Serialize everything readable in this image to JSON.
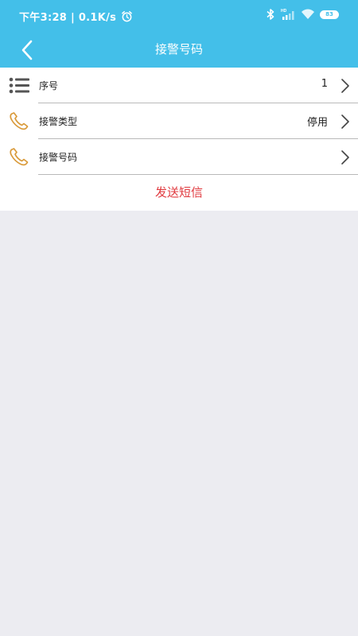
{
  "status_bar": {
    "time_speed": "下午3:28 | 0.1K/s",
    "battery": "83",
    "icons": [
      "alarm-icon",
      "bluetooth-icon",
      "signal-icon",
      "wifi-icon",
      "battery-icon"
    ]
  },
  "header": {
    "title": "接警号码",
    "back_icon": "back-chevron-icon"
  },
  "list": {
    "items": [
      {
        "label": "序号",
        "value": "1",
        "icon": "list-icon"
      },
      {
        "label": "接警类型",
        "value": "停用",
        "icon": "phone-icon"
      },
      {
        "label": "接警号码",
        "value": "",
        "icon": "phone-icon"
      }
    ]
  },
  "actions": {
    "send_sms": "发送短信"
  },
  "colors": {
    "header_bg": "#43bfe9",
    "page_bg": "#ececf1",
    "phone_icon": "#d99a3a",
    "action_text": "#e0393e"
  }
}
